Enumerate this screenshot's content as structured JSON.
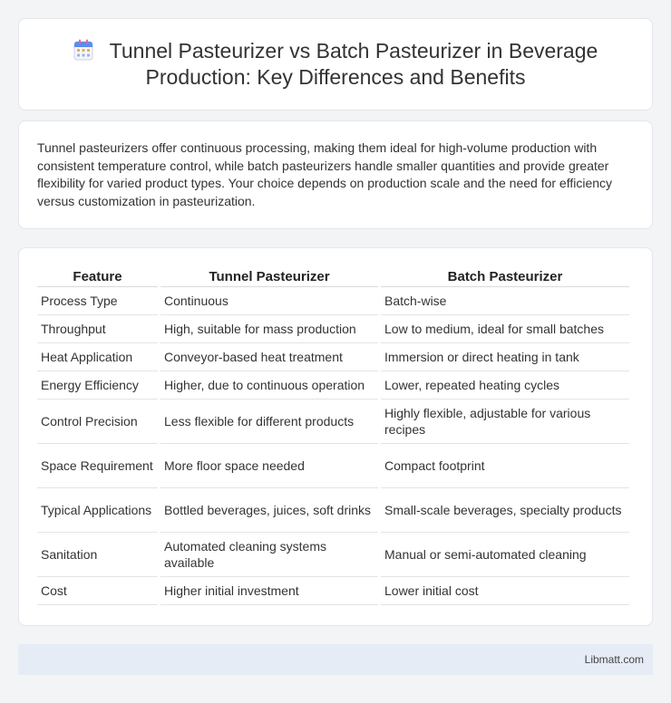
{
  "header": {
    "icon": "calendar-icon",
    "title": "Tunnel Pasteurizer vs Batch Pasteurizer in Beverage Production: Key Differences and Benefits"
  },
  "intro": "Tunnel pasteurizers offer continuous processing, making them ideal for high-volume production with consistent temperature control, while batch pasteurizers handle smaller quantities and provide greater flexibility for varied product types. Your choice depends on production scale and the need for efficiency versus customization in pasteurization.",
  "table": {
    "headers": [
      "Feature",
      "Tunnel Pasteurizer",
      "Batch Pasteurizer"
    ],
    "rows": [
      [
        "Process Type",
        "Continuous",
        "Batch-wise"
      ],
      [
        "Throughput",
        "High, suitable for mass production",
        "Low to medium, ideal for small batches"
      ],
      [
        "Heat Application",
        "Conveyor-based heat treatment",
        "Immersion or direct heating in tank"
      ],
      [
        "Energy Efficiency",
        "Higher, due to continuous operation",
        "Lower, repeated heating cycles"
      ],
      [
        "Control Precision",
        "Less flexible for different products",
        "Highly flexible, adjustable for various recipes"
      ],
      [
        "Space Requirement",
        "More floor space needed",
        "Compact footprint"
      ],
      [
        "Typical Applications",
        "Bottled beverages, juices, soft drinks",
        "Small-scale beverages, specialty products"
      ],
      [
        "Sanitation",
        "Automated cleaning systems available",
        "Manual or semi-automated cleaning"
      ],
      [
        "Cost",
        "Higher initial investment",
        "Lower initial cost"
      ]
    ]
  },
  "footer": {
    "brand": "Libmatt.com"
  }
}
